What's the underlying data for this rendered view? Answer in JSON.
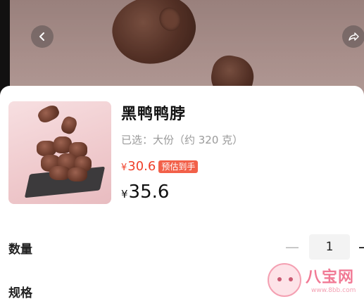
{
  "product": {
    "title": "黑鸭鸭脖",
    "selected_spec": "已选：大份（约 320 克）",
    "estimated_price": {
      "currency": "¥",
      "amount": "30.6",
      "badge": "预估到手"
    },
    "price": {
      "currency": "¥",
      "amount": "35.6"
    }
  },
  "quantity": {
    "label": "数量",
    "value": "1"
  },
  "spec": {
    "label": "规格"
  },
  "watermark": {
    "brand": "八宝网",
    "url": "www.8bb.com"
  },
  "icons": {
    "back": "chevron-left-icon",
    "share": "share-arrow-icon",
    "minus": "minus-icon",
    "plus": "plus-icon"
  },
  "colors": {
    "accent_price": "#f0402a",
    "badge_bg": "#f26049",
    "watermark": "#f06c8a"
  }
}
